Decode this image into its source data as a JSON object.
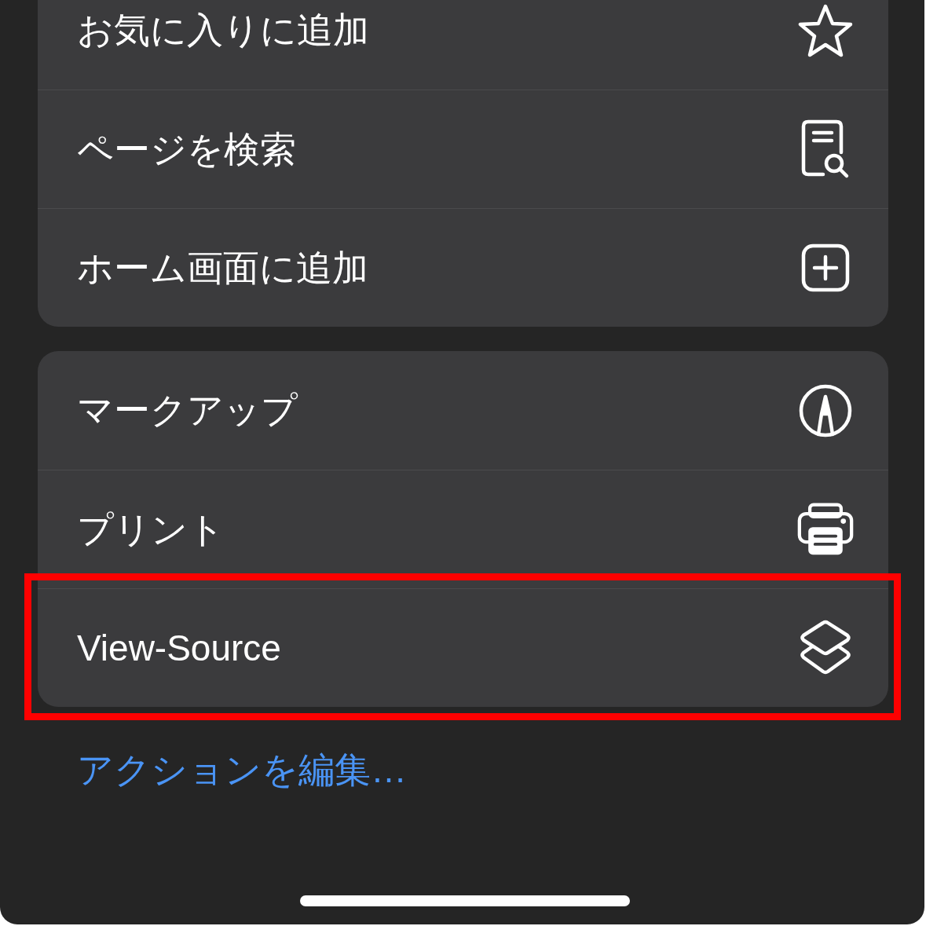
{
  "groups": [
    {
      "items": [
        {
          "label": "お気に入りに追加",
          "kind": "favorite",
          "highlighted": false
        },
        {
          "label": "ページを検索",
          "kind": "find",
          "highlighted": false
        },
        {
          "label": "ホーム画面に追加",
          "kind": "homescreen",
          "highlighted": false
        }
      ]
    },
    {
      "items": [
        {
          "label": "マークアップ",
          "kind": "markup",
          "highlighted": false
        },
        {
          "label": "プリント",
          "kind": "print",
          "highlighted": false
        },
        {
          "label": "View-Source",
          "kind": "shortcut",
          "highlighted": true
        }
      ]
    }
  ],
  "edit_link": {
    "label": "アクションを編集…"
  }
}
